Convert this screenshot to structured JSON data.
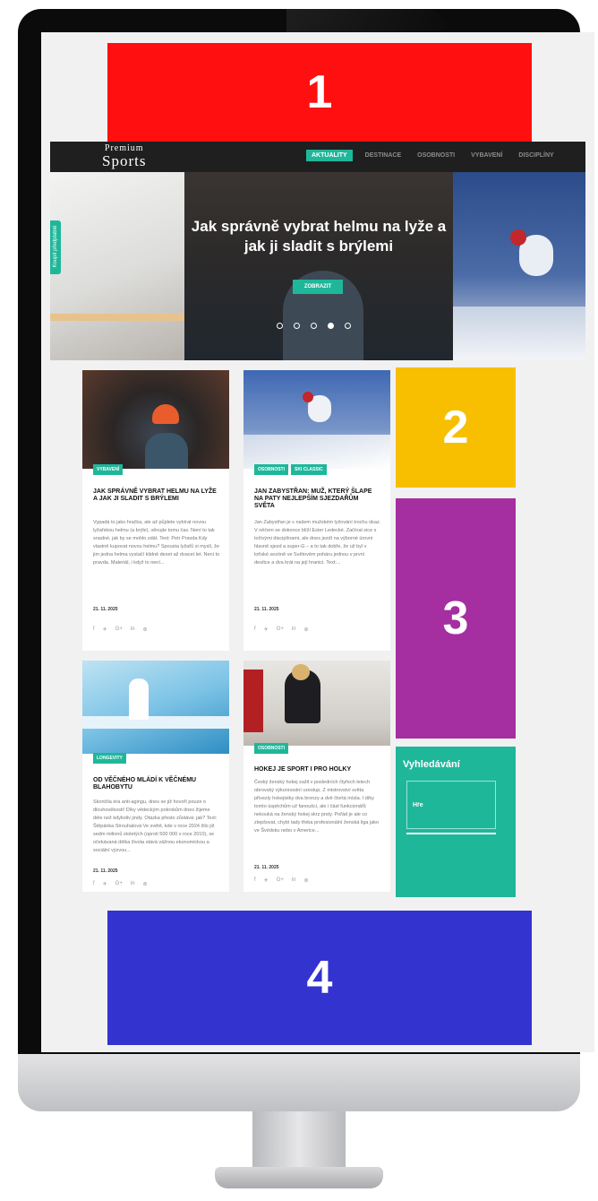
{
  "placeholders": {
    "one": "1",
    "two": "2",
    "three": "3",
    "four": "4"
  },
  "header": {
    "logo_top": "Premium",
    "logo_bottom": "Sports",
    "nav": [
      "AKTUALITY",
      "DESTINACE",
      "OSOBNOSTI",
      "VYBAVENÍ",
      "DISCIPLÍNY"
    ]
  },
  "hero": {
    "title": "Jak správně vybrat helmu na lyže a jak ji sladit s brýlemi",
    "button": "ZOBRAZIT",
    "side_tab": "Koupit předplatné",
    "slides_total": 5,
    "active_slide": 4
  },
  "articles": [
    {
      "tags": [
        "VYBAVENÍ"
      ],
      "title": "JAK SPRÁVNĚ VYBRAT HELMU NA LYŽE A JAK JI SLADIT S BRÝLEMI",
      "excerpt": "Vypadá to jako hračka, ale až půjdete vybírat novou lyžařskou helmu (a brýle), věnujte tomu čas. Není to tak snadné, jak by se mohlo zdát. Text: Petr Pravda Kdy vlastně kupovat novou helmu? Spousta lyžařů si myslí, že jim jedna helma vystačí klidně deset až dvacet let. Není to pravda. Materiál, i když to není...",
      "date": "21. 11. 2025"
    },
    {
      "tags": [
        "OSOBNOSTI",
        "SKI CLASSIC"
      ],
      "title": "JAN ZABYSTŘAN: MUŽ, KTERÝ ŠLAPE NA PATY NEJLEPŠÍM SJEZDAŘŮM SVĚTA",
      "excerpt": "Jan Zabystřan je v našem mužském lyžování trochu úkaz. V něčem se dokonce blíží Ester Ledecké. Začínal sice s točivými disciplínami, ale dnes jezdí na výborné úrovni hlavně sjezd a super-G – a to tak dobře, že už byl v loňské sezóně ve Světovém poháru jednou v první desítce a dva krát na její hranici. Text:...",
      "date": "21. 11. 2025"
    },
    {
      "tags": [
        "LONGEVITY"
      ],
      "title": "OD VĚČNÉHO MLÁDÍ K VĚČNÉMU BLAHOBYTU",
      "excerpt": "Skončila éra anti-agingu, dnes se již hovoří pouze o dlouhověkosti! Díky vědeckým pokrokům dnes žijeme déle než kdykoliv jindy. Otázka přesto zůstává: jak? Text: Štěpánka Strouhalová Ve světě, kde v roce 2024 žilo již sedm milionů stoletých (oproti 500 000 v roce 2010), se očekávaná délka života stává vážnou ekonomickou a sociální výzvou...",
      "date": "21. 11. 2025"
    },
    {
      "tags": [
        "OSOBNOSTI"
      ],
      "title": "HOKEJ JE SPORT I PRO HOLKY",
      "excerpt": "Český ženský hokej zažil v posledních čtyřech letech obrovský výkonnostní vzestup. Z mistrovství světa přivezly hokejistky dva bronzy a dvě čtvrtá místa. I díky tomto úspěchům už fanoušci, ale i část funkcionářů nekouká na ženský hokej skrz prsty. Pořád je ale co zlepšovat, chybí tady třeba profesionální ženská liga jako ve Švédsku nebo v Americe...",
      "date": "21. 11. 2025"
    }
  ],
  "social_icons": [
    "f",
    "♥",
    "G+",
    "in",
    "⊛"
  ],
  "search": {
    "title": "Vyhledávání",
    "placeholder": "Hře"
  },
  "colors": {
    "accent": "#1fb79a",
    "red": "#ff0f0f",
    "yellow": "#f7bf00",
    "purple": "#a52ea0",
    "blue": "#3333cf"
  }
}
